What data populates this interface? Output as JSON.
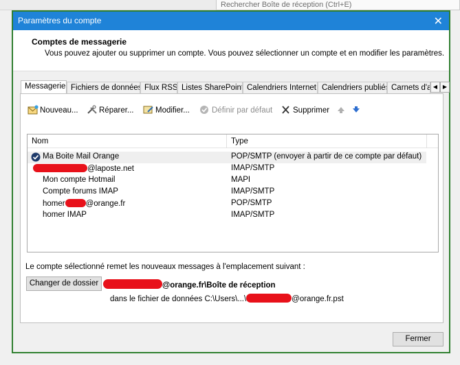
{
  "background": {
    "search_placeholder": "Rechercher Boîte de réception (Ctrl+E)"
  },
  "window": {
    "title": "Paramètres du compte",
    "close_glyph": "✕"
  },
  "header": {
    "title": "Comptes de messagerie",
    "subtitle": "Vous pouvez ajouter ou supprimer un compte. Vous pouvez sélectionner un compte et en modifier les paramètres."
  },
  "tabs": [
    {
      "label": "Messagerie"
    },
    {
      "label": "Fichiers de données"
    },
    {
      "label": "Flux RSS"
    },
    {
      "label": "Listes SharePoint"
    },
    {
      "label": "Calendriers Internet"
    },
    {
      "label": "Calendriers publiés"
    },
    {
      "label": "Carnets d'adresses"
    }
  ],
  "toolbar": {
    "new_label": "Nouveau...",
    "repair_label": "Réparer...",
    "modify_label": "Modifier...",
    "default_label": "Définir par défaut",
    "delete_label": "Supprimer"
  },
  "list": {
    "col_name": "Nom",
    "col_type": "Type",
    "rows": [
      {
        "name": "Ma Boite Mail Orange",
        "type": "POP/SMTP (envoyer à partir de ce compte par défaut)"
      },
      {
        "name_suffix": "@laposte.net",
        "type": "IMAP/SMTP"
      },
      {
        "name": "Mon compte Hotmail",
        "type": "MAPI"
      },
      {
        "name": "Compte forums IMAP",
        "type": "IMAP/SMTP"
      },
      {
        "name_prefix": "homer",
        "name_suffix": "@orange.fr",
        "type": "POP/SMTP"
      },
      {
        "name": "homer IMAP",
        "type": "IMAP/SMTP"
      }
    ]
  },
  "delivery": {
    "text": "Le compte sélectionné remet les nouveaux messages à l'emplacement suivant :",
    "change_button": "Changer de dossier",
    "folder_suffix": "@orange.fr\\Boîte de réception",
    "file_prefix": "dans le fichier de données C:\\Users\\...\\",
    "file_suffix": "@orange.fr.pst"
  },
  "footer": {
    "close_button": "Fermer"
  },
  "colors": {
    "titlebar": "#1f83d8",
    "redaction": "#e8111a",
    "frame": "#2f7f2f"
  }
}
